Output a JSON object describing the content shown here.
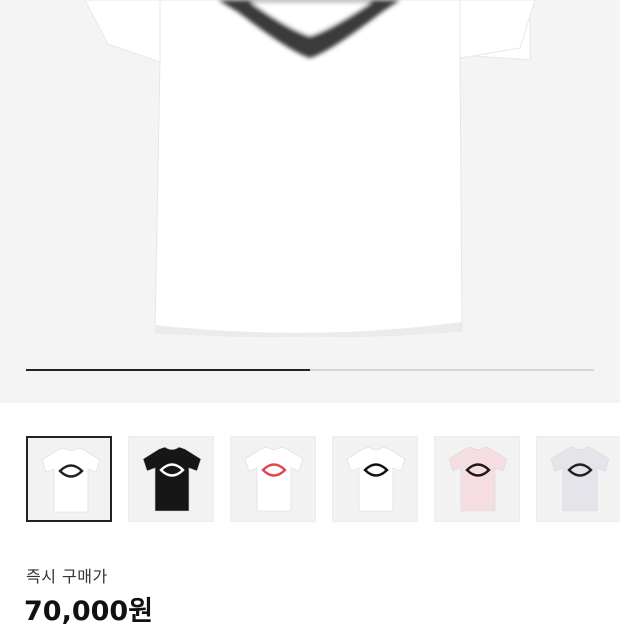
{
  "product": {
    "thumbnails": [
      {
        "color_name": "white-black-logo",
        "shirt": "#ffffff",
        "logo": "#222222",
        "selected": true
      },
      {
        "color_name": "black-white-logo",
        "shirt": "#161616",
        "logo": "#ffffff",
        "selected": false
      },
      {
        "color_name": "white-red-logo",
        "shirt": "#ffffff",
        "logo": "#e0474d",
        "selected": false
      },
      {
        "color_name": "white-black-logo-2",
        "shirt": "#ffffff",
        "logo": "#111111",
        "selected": false
      },
      {
        "color_name": "pink-black-logo",
        "shirt": "#f6dde1",
        "logo": "#1a1a1a",
        "selected": false
      },
      {
        "color_name": "gray-black-logo",
        "shirt": "#e4e4ea",
        "logo": "#222222",
        "selected": false
      }
    ],
    "image_progress": 0.5
  },
  "price": {
    "label": "즉시 구매가",
    "value": "70,000원"
  }
}
